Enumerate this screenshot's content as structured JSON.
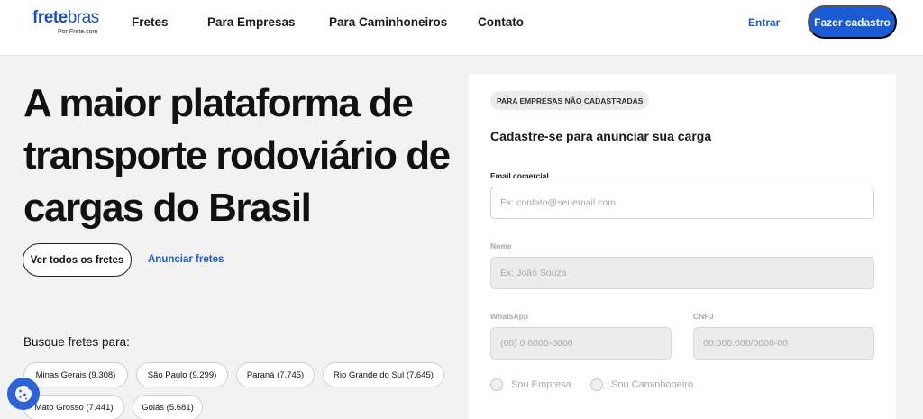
{
  "header": {
    "logo": {
      "part1": "frete",
      "part2": "bras",
      "sub": "Por Frete.com"
    },
    "nav": [
      "Fretes",
      "Para Empresas",
      "Para Caminhoneiros",
      "Contato"
    ],
    "login_label": "Entrar",
    "signup_label": "Fazer cadastro"
  },
  "hero": {
    "title": "A maior plataforma de transporte rodoviário de cargas do Brasil",
    "primary_button": "Ver todos os fretes",
    "secondary_link": "Anunciar fretes",
    "search_label": "Busque fretes para:",
    "states": [
      "Minas Gerais (9.308)",
      "São Paulo (9.299)",
      "Paraná (7.745)",
      "Rio Grande do Sul (7.645)",
      "Mato Grosso (7.441)",
      "Goiás (5.681)"
    ]
  },
  "form": {
    "tag": "PARA EMPRESAS NÃO CADASTRADAS",
    "title": "Cadastre-se para anunciar sua carga",
    "email": {
      "label": "Email comercial",
      "placeholder": "Ex: contato@seuemail.com"
    },
    "name": {
      "label": "Nome",
      "placeholder": "Ex: João Souza"
    },
    "whatsapp": {
      "label": "WhatsApp",
      "placeholder": "(00) 0 0000-0000"
    },
    "cnpj": {
      "label": "CNPJ",
      "placeholder": "00.000.000/0000-00"
    },
    "radio_company": "Sou Empresa",
    "radio_driver": "Sou Caminhoneiro"
  },
  "colors": {
    "brand": "#1c5bd6",
    "background": "#f2f2f2"
  },
  "icons": {
    "cookie": "cookie-icon"
  }
}
